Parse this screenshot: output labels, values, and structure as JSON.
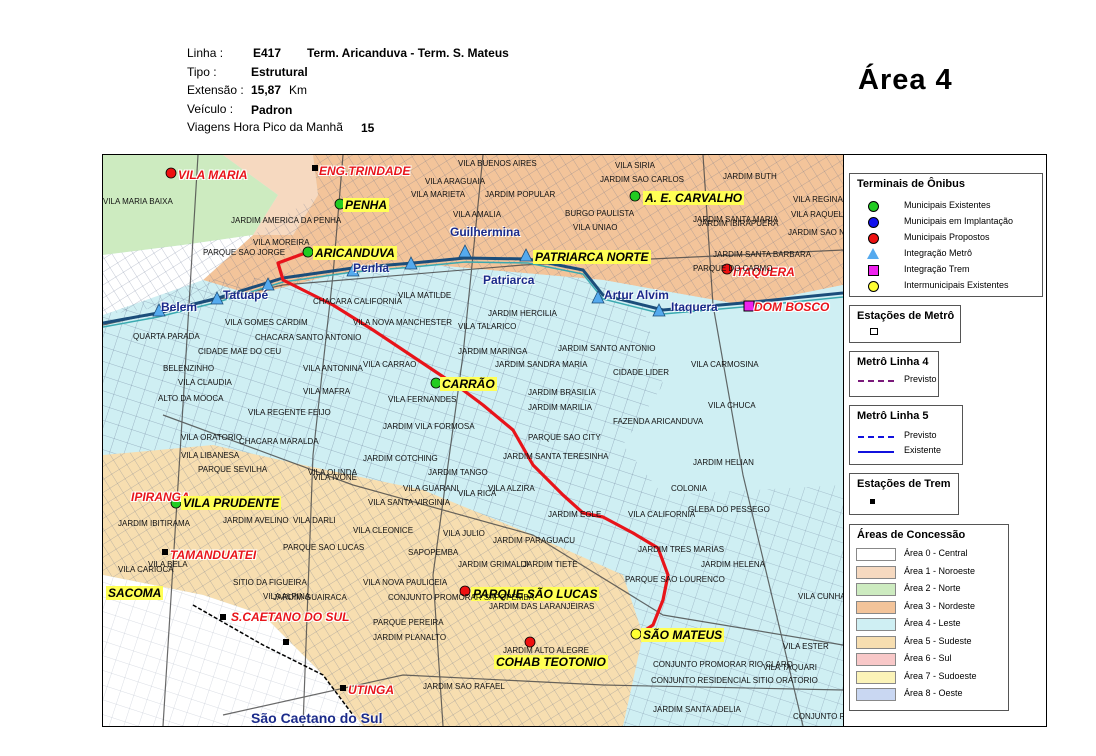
{
  "header": {
    "linha_label": "Linha :",
    "linha_code": "E417",
    "linha_name": "Term. Aricanduva - Term. S. Mateus",
    "tipo_label": "Tipo :",
    "tipo_value": "Estrutural",
    "extensao_label": "Extensão :",
    "extensao_value": "15,87",
    "extensao_unit": "Km",
    "veiculo_label": "Veículo :",
    "veiculo_value": "Padron",
    "viagens_label": "Viagens Hora Pico da Manhã",
    "viagens_value": "15"
  },
  "area_title": "Área  4",
  "colors": {
    "route": "#e8141a",
    "area0": "#ffffff",
    "area1": "#f6d9c0",
    "area2": "#cdebc0",
    "area3": "#f3c49a",
    "area4": "#cfeff3",
    "area5": "#f7deb0",
    "area6": "#f8c8c8",
    "area7": "#fbf3b8",
    "area8": "#c9d7f2",
    "terminal_existing": "#22cc22",
    "terminal_implant": "#1111ee",
    "terminal_proposed": "#ee1111",
    "integration_metro": "#55aaee",
    "integration_train": "#ee22ee",
    "intermunicipal": "#ffff33"
  },
  "map_labels": {
    "red": [
      {
        "text": "VILA MARIA"
      },
      {
        "text": "ENG.TRINDADE"
      },
      {
        "text": "ITAQUERA"
      },
      {
        "text": "DOM BOSCO"
      },
      {
        "text": "IPIRANGA"
      },
      {
        "text": "TAMANDUATEI"
      },
      {
        "text": "S.CAETANO DO SUL"
      },
      {
        "text": "UTINGA"
      }
    ],
    "yellow": [
      {
        "text": "PENHA"
      },
      {
        "text": "ARICANDUVA"
      },
      {
        "text": "A. E. CARVALHO"
      },
      {
        "text": "PATRIARCA NORTE"
      },
      {
        "text": "CARRÃO"
      },
      {
        "text": "VILA PRUDENTE"
      },
      {
        "text": "SACOMA"
      },
      {
        "text": "PARQUE SÃO LUCAS"
      },
      {
        "text": "SÃO MATEUS"
      },
      {
        "text": "COHAB TEOTONIO"
      }
    ],
    "metro": [
      {
        "text": "Guilhermina"
      },
      {
        "text": "Penha"
      },
      {
        "text": "Patriarca"
      },
      {
        "text": "Artur Alvim"
      },
      {
        "text": "Itaquera"
      },
      {
        "text": "Tatuapé"
      },
      {
        "text": "Belem"
      },
      {
        "text": "São Caetano do Sul"
      }
    ],
    "neighborhoods": [
      "VILA BUENOS AIRES",
      "VILA SIRIA",
      "JARDIM SAO CARLOS",
      "JARDIM BUTH",
      "VILA ARAGUAIA",
      "VILA MARIETA",
      "JARDIM POPULAR",
      "VILA AMALIA",
      "BURGO PAULISTA",
      "VILA UNIAO",
      "JARDIM AMERICA DA PENHA",
      "VILA MARIA BAIXA",
      "VILA MOREIRA",
      "PARQUE SAO JORGE",
      "JARDIM SANTA MARIA",
      "VILA MATILDE",
      "CHACARA CALIFORNIA",
      "VILA GOMES CARDIM",
      "VILA NOVA MANCHESTER",
      "VILA TALARICO",
      "JARDIM HERCILIA",
      "QUARTA PARADA",
      "CHACARA SANTO ANTONIO",
      "CIDADE MAE DO CEU",
      "JARDIM MARINGA",
      "JARDIM SANTO ANTONIO",
      "JARDIM SANDRA MARIA",
      "BELENZINHO",
      "VILA ANTONINA",
      "VILA CARRAO",
      "CIDADE LIDER",
      "VILA CARMOSINA",
      "VILA CLAUDIA",
      "ALTO DA MOOCA",
      "VILA MAFRA",
      "VILA FERNANDES",
      "JARDIM BRASILIA",
      "JARDIM MARILIA",
      "VILA CHUCA",
      "VILA REGENTE FEIJO",
      "FAZENDA ARICANDUVA",
      "VILA ORATORIO",
      "JARDIM VILA FORMOSA",
      "PARQUE SAO CITY",
      "CHACARA MARALDA",
      "VILA LIBANESA",
      "JARDIM COTCHING",
      "JARDIM SANTA TERESINHA",
      "JARDIM HELIAN",
      "PARQUE SEVILHA",
      "VILA OLINDA",
      "JARDIM TANGO",
      "VILA IVONE",
      "VILA GUARANI",
      "VILA ALZIRA",
      "COLONIA",
      "VILA SANTA VIRGINIA",
      "VILA RICA",
      "GLEBA DO PESSEGO",
      "JARDIM AVELINO",
      "VILA DARLI",
      "JARDIM EGLE",
      "VILA CALIFORNIA",
      "JARDIM IBITIRAMA",
      "VILA CLEONICE",
      "VILA JULIO",
      "PARQUE SAO LUCAS",
      "JARDIM PARAGUACU",
      "JARDIM TRES MARIAS",
      "SAPOPEMBA",
      "JARDIM HELENA",
      "VILA CARIOCA",
      "VILA BELA",
      "JARDIM GRIMALDI",
      "JARDIM TIETE",
      "PARQUE SAO LOURENCO",
      "SITIO DA FIGUEIRA",
      "VILA NOVA PAULICEIA",
      "VILA ALPINA",
      "JARDIM GUAIRACA",
      "CONJUNTO PROMORAR SAPOPEMBA",
      "JARDIM DAS LARANJEIRAS",
      "VILA CUNHA BUENO",
      "PARQUE PEREIRA",
      "JARDIM PLANALTO",
      "JARDIM ALTO ALEGRE",
      "VILA ESTER",
      "CONJUNTO PROMORAR RIO CLARO",
      "CONJUNTO RESIDENCIAL SITIO ORATORIO",
      "JARDIM SAO RAFAEL",
      "JARDIM SANTA ADELIA",
      "CONJUNTO RESIDENCIAL JOSE BONIFACIO",
      "VILA TAQUARI",
      "JARDIM IBIRAPUERA",
      "JARDIM SAO NICOLAU",
      "VILA RAQUEL",
      "VILA REGINA",
      "PARQUE DO CARMO",
      "JARDIM SANTA BARBARA"
    ]
  },
  "legend": {
    "terminals": {
      "title": "Terminais de Ônibus",
      "items": [
        {
          "label": "Municipais Existentes",
          "color": "#22cc22",
          "shape": "circle"
        },
        {
          "label": "Municipais em Implantação",
          "color": "#1111ee",
          "shape": "circle"
        },
        {
          "label": "Municipais Propostos",
          "color": "#ee1111",
          "shape": "circle"
        },
        {
          "label": "Integração Metrô",
          "color": "#55aaee",
          "shape": "triangle"
        },
        {
          "label": "Integração Trem",
          "color": "#ee22ee",
          "shape": "square"
        },
        {
          "label": "Intermunicipais Existentes",
          "color": "#ffff33",
          "shape": "circle"
        }
      ]
    },
    "metro_stations": {
      "title": "Estações de Metrô"
    },
    "metro_l4": {
      "title": "Metrô Linha 4",
      "items": [
        {
          "label": "Previsto",
          "color": "#7a1a7a"
        }
      ]
    },
    "metro_l5": {
      "title": "Metrô Linha 5",
      "items": [
        {
          "label": "Previsto",
          "color": "#1111dd",
          "dashed": true
        },
        {
          "label": "Existente",
          "color": "#1111dd",
          "dashed": false
        }
      ]
    },
    "train_stations": {
      "title": "Estações de Trem"
    },
    "areas": {
      "title": "Áreas de Concessão",
      "items": [
        {
          "label": "Área 0 - Central",
          "color": "#ffffff"
        },
        {
          "label": "Área 1 - Noroeste",
          "color": "#f6d9c0"
        },
        {
          "label": "Área 2 - Norte",
          "color": "#cdebc0"
        },
        {
          "label": "Área 3 - Nordeste",
          "color": "#f3c49a"
        },
        {
          "label": "Área 4 - Leste",
          "color": "#cfeff3"
        },
        {
          "label": "Área 5 - Sudeste",
          "color": "#f7deb0"
        },
        {
          "label": "Área 6 - Sul",
          "color": "#f8c8c8"
        },
        {
          "label": "Área 7 - Sudoeste",
          "color": "#fbf3b8"
        },
        {
          "label": "Área 8 - Oeste",
          "color": "#c9d7f2"
        }
      ]
    }
  }
}
